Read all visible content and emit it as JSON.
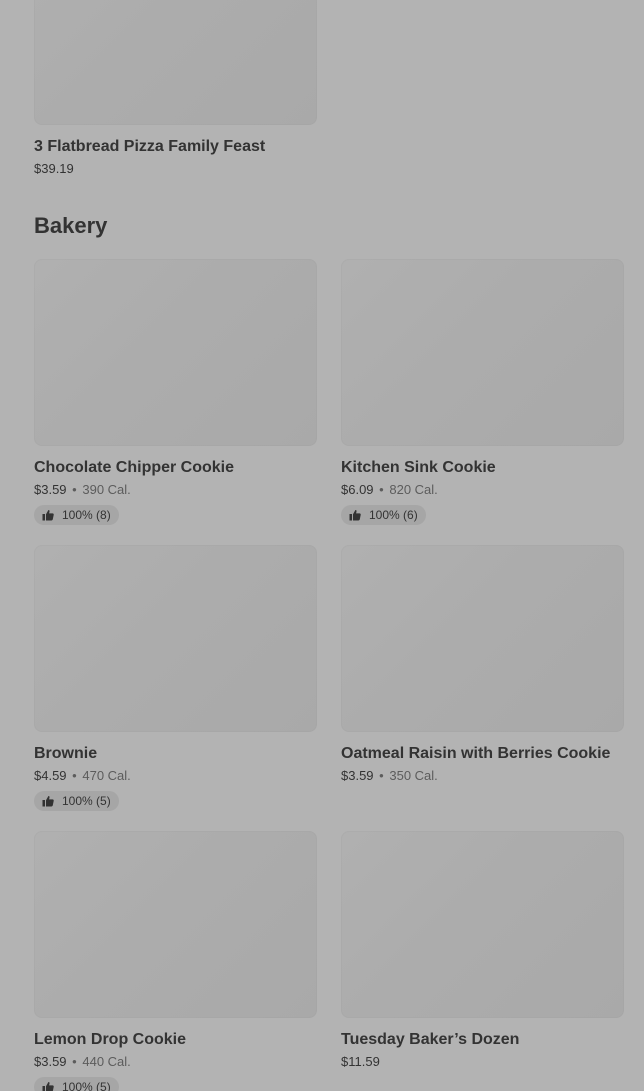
{
  "top_item": {
    "name": "3 Flatbread Pizza Family Feast",
    "price": "$39.19"
  },
  "section": {
    "title": "Bakery"
  },
  "items": [
    {
      "name": "Chocolate Chipper Cookie",
      "price": "$3.59",
      "separator": "•",
      "calories": "390 Cal.",
      "rating": "100% (8)"
    },
    {
      "name": "Kitchen Sink Cookie",
      "price": "$6.09",
      "separator": "•",
      "calories": "820 Cal.",
      "rating": "100% (6)"
    },
    {
      "name": "Brownie",
      "price": "$4.59",
      "separator": "•",
      "calories": "470 Cal.",
      "rating": "100% (5)"
    },
    {
      "name": "Oatmeal Raisin with Berries Cookie",
      "price": "$3.59",
      "separator": "•",
      "calories": "350 Cal."
    },
    {
      "name": "Lemon Drop Cookie",
      "price": "$3.59",
      "separator": "•",
      "calories": "440 Cal.",
      "rating": "100% (5)"
    },
    {
      "name": "Tuesday Baker’s Dozen",
      "price": "$11.59"
    }
  ],
  "icons": {
    "rating_icon": "thumbs-up-icon"
  },
  "colors": {
    "background": "#b3b3b3",
    "text": "#333333",
    "muted": "#5c5c5c",
    "badge": "#a6a6a6"
  }
}
